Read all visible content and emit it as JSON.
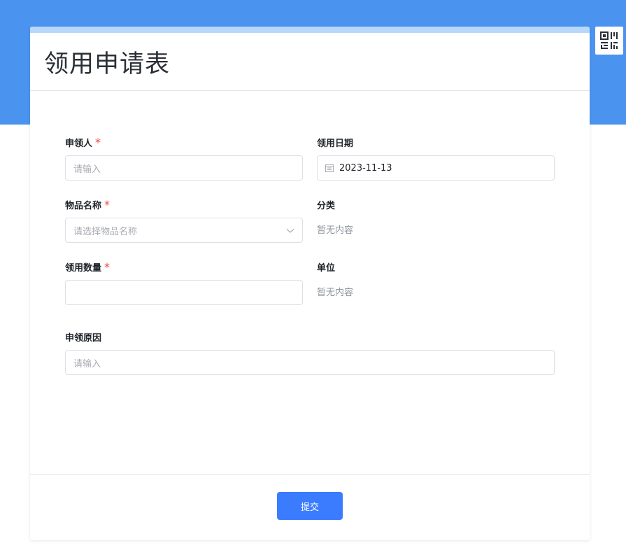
{
  "header": {
    "title": "领用申请表"
  },
  "toolbar": {
    "qr_icon": "qrcode-icon"
  },
  "form": {
    "applicant": {
      "label": "申领人",
      "required_mark": "*",
      "placeholder": "请输入"
    },
    "date": {
      "label": "领用日期",
      "value": "2023-11-13",
      "icon": "calendar-icon"
    },
    "item_name": {
      "label": "物品名称",
      "required_mark": "*",
      "placeholder": "请选择物品名称",
      "icon": "chevron-down-icon"
    },
    "category": {
      "label": "分类",
      "value": "暂无内容"
    },
    "quantity": {
      "label": "领用数量",
      "required_mark": "*",
      "value": ""
    },
    "unit": {
      "label": "单位",
      "value": "暂无内容"
    },
    "reason": {
      "label": "申领原因",
      "placeholder": "请输入"
    }
  },
  "footer": {
    "submit_label": "提交"
  },
  "colors": {
    "header_band": "#4a94f0",
    "accent": "#3b7cff",
    "required": "#f54a45"
  }
}
